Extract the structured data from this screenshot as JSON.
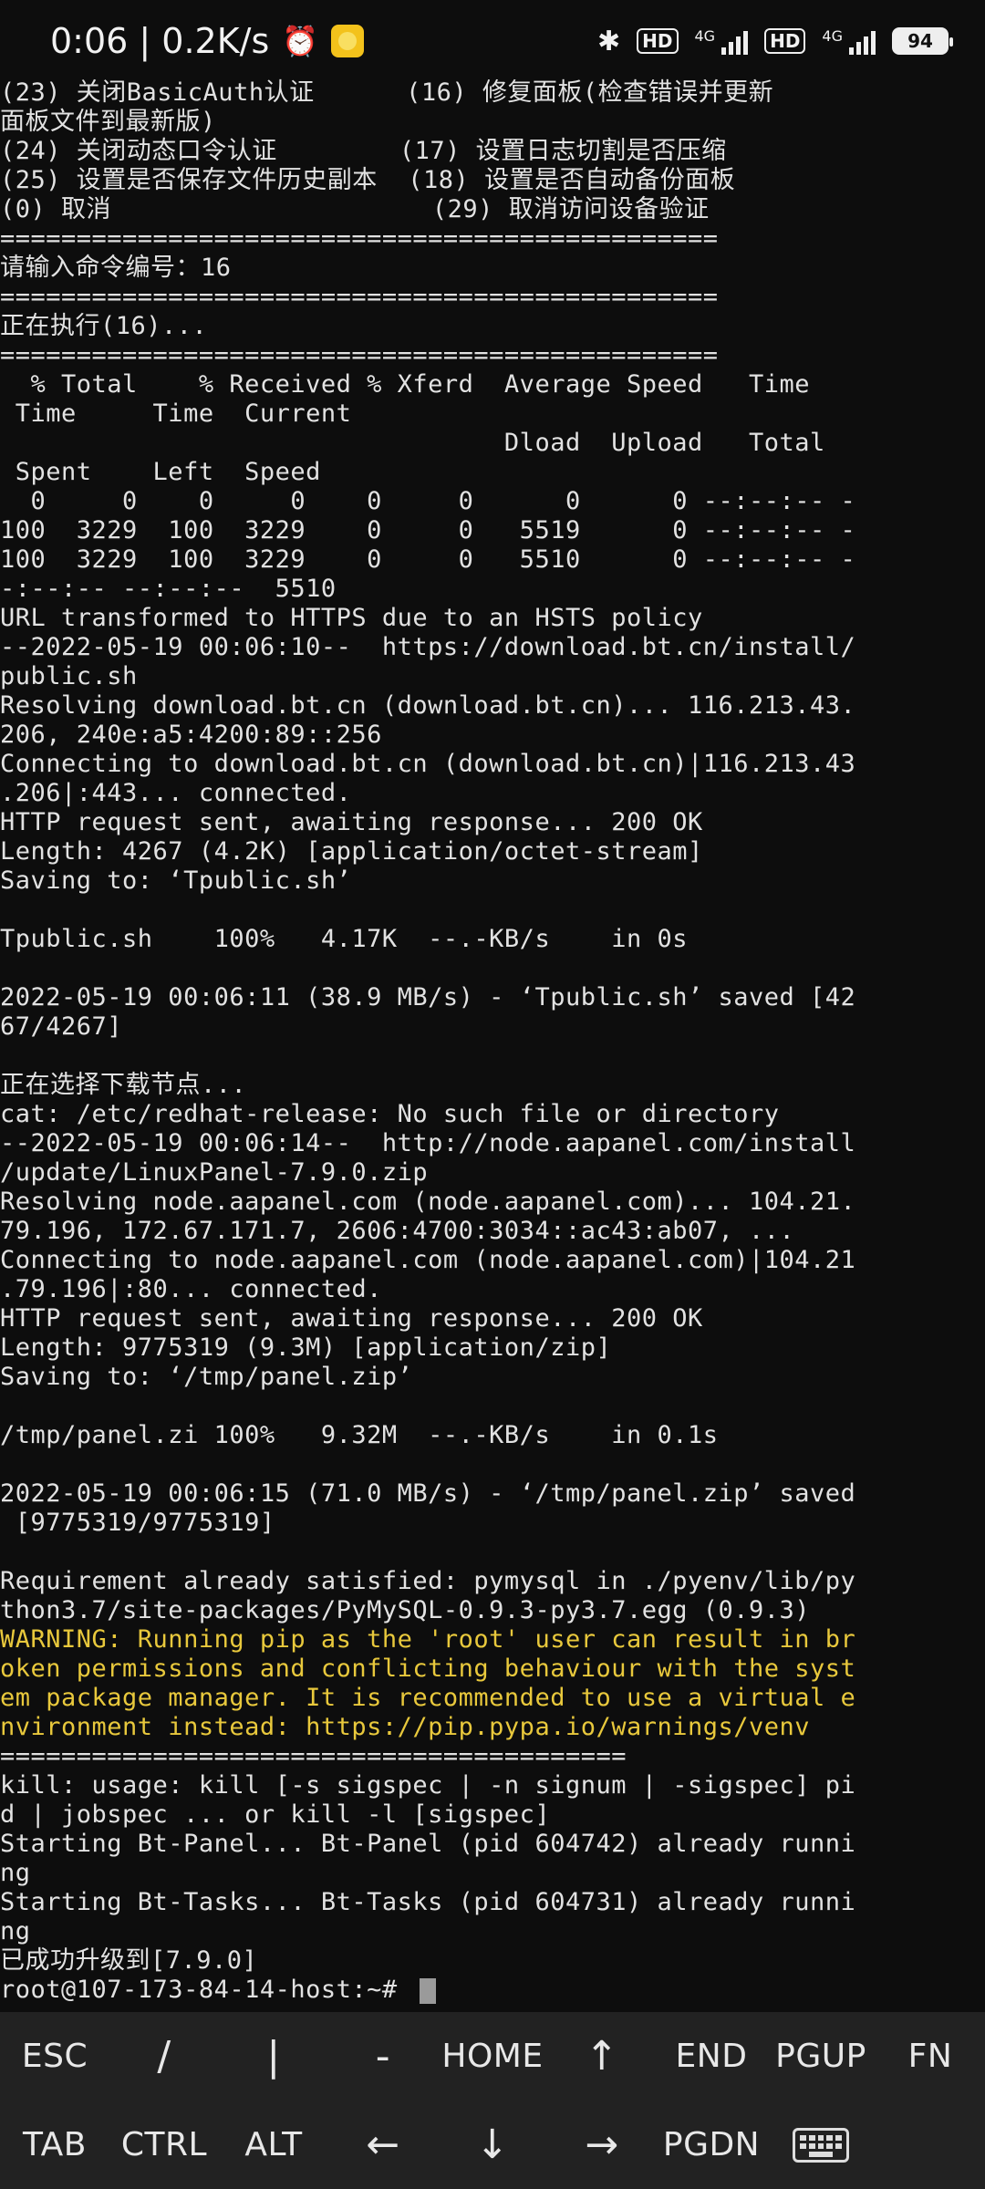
{
  "status_bar": {
    "time_speed": "0:06 | 0.2K/s",
    "alarm_glyph": "⏰",
    "network_1": "4G",
    "network_2": "4G",
    "hd_1": "HD",
    "hd_2": "HD",
    "battery": "94",
    "bluetooth_glyph": "✱"
  },
  "terminal": {
    "lines": [
      "(23) 关闭BasicAuth认证      (16) 修复面板(检查错误并更新",
      "面板文件到最新版)",
      "(24) 关闭动态口令认证        (17) 设置日志切割是否压缩",
      "(25) 设置是否保存文件历史副本  (18) 设置是否自动备份面板",
      "(0) 取消                     (29) 取消访问设备验证",
      "===============================================",
      "请输入命令编号：16",
      "===============================================",
      "正在执行(16)...",
      "===============================================",
      "  % Total    % Received % Xferd  Average Speed   Time",
      " Time     Time  Current",
      "                                 Dload  Upload   Total",
      " Spent    Left  Speed",
      "  0     0    0     0    0     0      0      0 --:--:-- -",
      "100  3229  100  3229    0     0   5519      0 --:--:-- -",
      "100  3229  100  3229    0     0   5510      0 --:--:-- -",
      "-:--:-- --:--:--  5510",
      "URL transformed to HTTPS due to an HSTS policy",
      "--2022-05-19 00:06:10--  https://download.bt.cn/install/",
      "public.sh",
      "Resolving download.bt.cn (download.bt.cn)... 116.213.43.",
      "206, 240e:a5:4200:89::256",
      "Connecting to download.bt.cn (download.bt.cn)|116.213.43",
      ".206|:443... connected.",
      "HTTP request sent, awaiting response... 200 OK",
      "Length: 4267 (4.2K) [application/octet-stream]",
      "Saving to: ‘Tpublic.sh’",
      "",
      "Tpublic.sh    100%   4.17K  --.-KB/s    in 0s",
      "",
      "2022-05-19 00:06:11 (38.9 MB/s) - ‘Tpublic.sh’ saved [42",
      "67/4267]",
      "",
      "正在选择下载节点...",
      "cat: /etc/redhat-release: No such file or directory",
      "--2022-05-19 00:06:14--  http://node.aapanel.com/install",
      "/update/LinuxPanel-7.9.0.zip",
      "Resolving node.aapanel.com (node.aapanel.com)... 104.21.",
      "79.196, 172.67.171.7, 2606:4700:3034::ac43:ab07, ...",
      "Connecting to node.aapanel.com (node.aapanel.com)|104.21",
      ".79.196|:80... connected.",
      "HTTP request sent, awaiting response... 200 OK",
      "Length: 9775319 (9.3M) [application/zip]",
      "Saving to: ‘/tmp/panel.zip’",
      "",
      "/tmp/panel.zi 100%   9.32M  --.-KB/s    in 0.1s",
      "",
      "2022-05-19 00:06:15 (71.0 MB/s) - ‘/tmp/panel.zip’ saved",
      " [9775319/9775319]",
      "",
      "Requirement already satisfied: pymysql in ./pyenv/lib/py",
      "thon3.7/site-packages/PyMySQL-0.9.3-py3.7.egg (0.9.3)",
      "WARNING: Running pip as the 'root' user can result in br",
      "oken permissions and conflicting behaviour with the syst",
      "em package manager. It is recommended to use a virtual e",
      "nvironment instead: https://pip.pypa.io/warnings/venv",
      "=========================================",
      "kill: usage: kill [-s sigspec | -n signum | -sigspec] pi",
      "d | jobspec ... or kill -l [sigspec]",
      "Starting Bt-Panel... Bt-Panel (pid 604742) already runni",
      "ng",
      "Starting Bt-Tasks... Bt-Tasks (pid 604731) already runni",
      "ng",
      "已成功升级到[7.9.0]",
      "root@107-173-84-14-host:~# "
    ],
    "warning_line_indices": [
      53,
      54,
      55,
      56
    ]
  },
  "extra_keys": {
    "row1": [
      "ESC",
      "/",
      "|",
      "-",
      "HOME",
      "↑",
      "END",
      "PGUP",
      "FN"
    ],
    "row2": [
      "TAB",
      "CTRL",
      "ALT",
      "←",
      "↓",
      "→",
      "PGDN"
    ],
    "keyboard_icon": "keyboard-icon"
  }
}
